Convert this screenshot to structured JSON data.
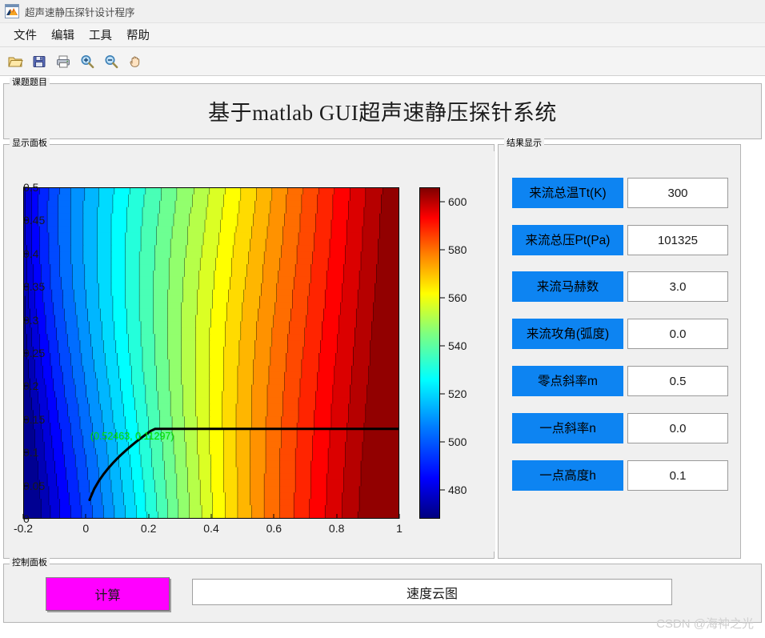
{
  "window": {
    "title": "超声速静压探针设计程序",
    "icon": "matlab-membrane-icon"
  },
  "menubar": {
    "items": [
      {
        "label": "文件",
        "name": "menu-file"
      },
      {
        "label": "编辑",
        "name": "menu-edit"
      },
      {
        "label": "工具",
        "name": "menu-tools"
      },
      {
        "label": "帮助",
        "name": "menu-help"
      }
    ]
  },
  "toolbar": {
    "buttons": [
      {
        "icon": "open-folder-icon",
        "name": "toolbar-open"
      },
      {
        "icon": "save-floppy-icon",
        "name": "toolbar-save"
      },
      {
        "icon": "print-icon",
        "name": "toolbar-print"
      },
      {
        "icon": "zoom-in-icon",
        "name": "toolbar-zoom-in"
      },
      {
        "icon": "zoom-out-icon",
        "name": "toolbar-zoom-out"
      },
      {
        "icon": "pan-hand-icon",
        "name": "toolbar-pan"
      }
    ]
  },
  "title_panel": {
    "panel_label": "课题题目",
    "heading": "基于matlab GUI超声速静压探针系统"
  },
  "display_panel": {
    "panel_label": "显示面板"
  },
  "result_panel": {
    "panel_label": "结果显示",
    "fields": [
      {
        "label": "来流总温Tt(K)",
        "value": "300"
      },
      {
        "label": "来流总压Pt(Pa)",
        "value": "101325"
      },
      {
        "label": "来流马赫数",
        "value": "3.0"
      },
      {
        "label": "来流攻角(弧度)",
        "value": "0.0"
      },
      {
        "label": "零点斜率m",
        "value": "0.5"
      },
      {
        "label": "一点斜率n",
        "value": "0.0"
      },
      {
        "label": "一点高度h",
        "value": "0.1"
      }
    ]
  },
  "control_panel": {
    "panel_label": "控制面板",
    "calculate_label": "计算",
    "dropdown_value": "速度云图",
    "dropdown_options": [
      "速度云图"
    ]
  },
  "watermark": "CSDN @海神之光",
  "colors": {
    "label_blue": "#0d84f2",
    "button_magenta": "#ff00ff",
    "panel_bg": "#f0f0f0",
    "annotation_green": "#00ee00"
  },
  "chart_data": {
    "type": "heatmap",
    "title": "",
    "xlabel": "",
    "ylabel": "",
    "colormap": "jet",
    "grid": false,
    "xlim": [
      -0.2,
      1.0
    ],
    "ylim": [
      0.0,
      0.5
    ],
    "xticks": [
      "-0.2",
      "0",
      "0.2",
      "0.4",
      "0.6",
      "0.8",
      "1"
    ],
    "xtick_values": [
      -0.2,
      0,
      0.2,
      0.4,
      0.6,
      0.8,
      1
    ],
    "yticks": [
      "0",
      "0.05",
      "0.1",
      "0.15",
      "0.2",
      "0.25",
      "0.3",
      "0.35",
      "0.4",
      "0.45",
      "0.5"
    ],
    "ytick_values": [
      0,
      0.05,
      0.1,
      0.15,
      0.2,
      0.25,
      0.3,
      0.35,
      0.4,
      0.45,
      0.5
    ],
    "colorbar": {
      "position": "right",
      "ticks": [
        "480",
        "500",
        "520",
        "540",
        "560",
        "580",
        "600"
      ],
      "tick_values": [
        480,
        500,
        520,
        540,
        560,
        580,
        600
      ],
      "range": [
        468,
        606
      ]
    },
    "annotations": [
      {
        "text": "(0.52463,  0.11297)",
        "x": 0.52463,
        "y": 0.11297,
        "color": "#00ee00"
      }
    ],
    "contour_levels": [
      470,
      475,
      480,
      485,
      490,
      495,
      500,
      505,
      510,
      515,
      520,
      525,
      530,
      535,
      540,
      545,
      550,
      555,
      560,
      565,
      570,
      575,
      580,
      585,
      590,
      595,
      600,
      605
    ],
    "description": "Velocity contour field rising from ~470 m/s (dark blue, left) to ~605 m/s (dark red, right), with a thick black probe-body curve from bottom-left rising to the right."
  }
}
